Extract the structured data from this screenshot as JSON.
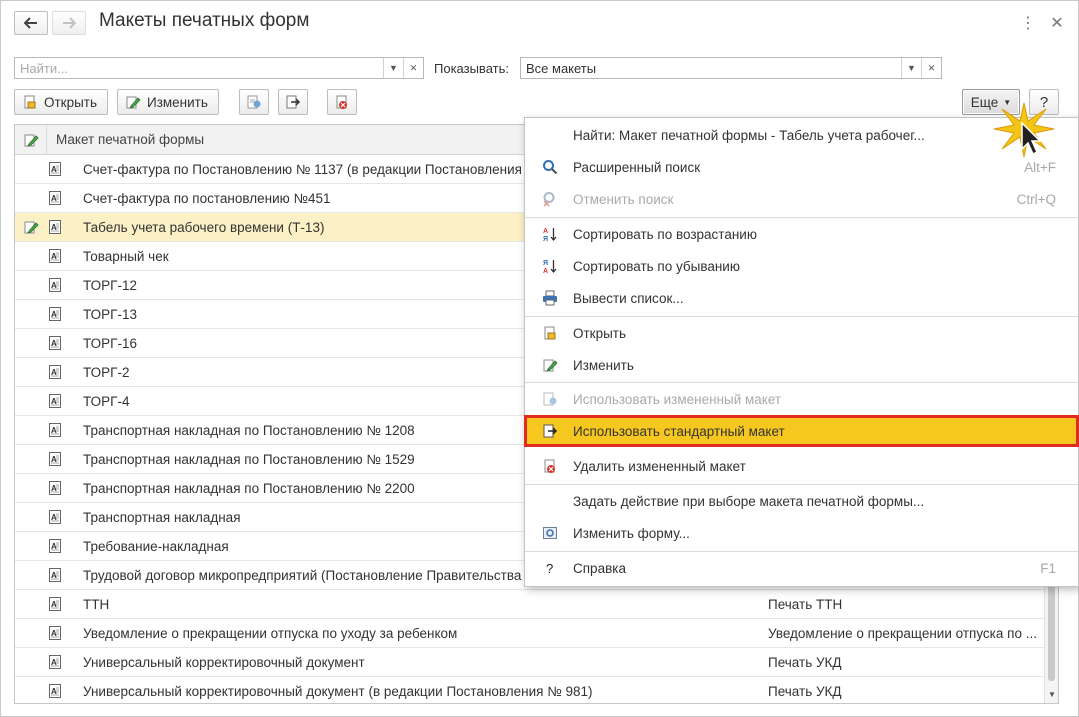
{
  "window": {
    "title": "Макеты печатных форм",
    "menu_icon": "⋮",
    "close_icon": "✕"
  },
  "filter": {
    "search_placeholder": "Найти...",
    "show_label": "Показывать:",
    "show_value": "Все макеты"
  },
  "toolbar": {
    "open_label": "Открыть",
    "edit_label": "Изменить",
    "more_label": "Еще",
    "help_label": "?"
  },
  "table": {
    "column_header": "Макет печатной формы",
    "rows": [
      {
        "name": "Счет-фактура по Постановлению № 1137 (в редакции Постановления N",
        "print": ""
      },
      {
        "name": "Счет-фактура по постановлению №451",
        "print": ""
      },
      {
        "name": "Табель учета рабочего времени (Т-13)",
        "print": "",
        "selected": true
      },
      {
        "name": "Товарный чек",
        "print": ""
      },
      {
        "name": "ТОРГ-12",
        "print": ""
      },
      {
        "name": "ТОРГ-13",
        "print": ""
      },
      {
        "name": "ТОРГ-16",
        "print": ""
      },
      {
        "name": "ТОРГ-2",
        "print": ""
      },
      {
        "name": "ТОРГ-4",
        "print": ""
      },
      {
        "name": "Транспортная накладная по Постановлению № 1208",
        "print": ""
      },
      {
        "name": "Транспортная накладная по Постановлению № 1529",
        "print": ""
      },
      {
        "name": "Транспортная накладная по Постановлению № 2200",
        "print": ""
      },
      {
        "name": "Транспортная накладная",
        "print": ""
      },
      {
        "name": "Требование-накладная",
        "print": ""
      },
      {
        "name": "Трудовой договор микропредприятий (Постановление Правительства Р",
        "print": ""
      },
      {
        "name": "ТТН",
        "print": "Печать ТТН"
      },
      {
        "name": "Уведомление о прекращении отпуска по уходу за ребенком",
        "print": "Уведомление о прекращении отпуска по ..."
      },
      {
        "name": "Универсальный корректировочный документ",
        "print": "Печать УКД"
      },
      {
        "name": "Универсальный корректировочный документ (в редакции Постановления № 981)",
        "print": "Печать УКД"
      }
    ]
  },
  "menu": {
    "items": [
      {
        "label": "Найти: Макет печатной формы - Табель учета рабочег...",
        "key": "",
        "icon": "none"
      },
      {
        "label": "Расширенный поиск",
        "key": "Alt+F",
        "icon": "magnifier-icon"
      },
      {
        "label": "Отменить поиск",
        "key": "Ctrl+Q",
        "icon": "cancel-search-icon",
        "disabled": true
      },
      {
        "label": "Сортировать по возрастанию",
        "key": "",
        "icon": "sort-asc-icon"
      },
      {
        "label": "Сортировать по убыванию",
        "key": "",
        "icon": "sort-desc-icon"
      },
      {
        "label": "Вывести список...",
        "key": "",
        "icon": "print-list-icon"
      },
      {
        "label": "Открыть",
        "key": "",
        "icon": "open-icon"
      },
      {
        "label": "Изменить",
        "key": "",
        "icon": "edit-icon"
      },
      {
        "label": "Использовать измененный макет",
        "key": "",
        "icon": "use-modified-icon",
        "disabled": true
      },
      {
        "label": "Использовать стандартный макет",
        "key": "",
        "icon": "use-standard-icon",
        "highlighted": true
      },
      {
        "label": "Удалить измененный макет",
        "key": "",
        "icon": "delete-modified-icon"
      },
      {
        "label": "Задать действие при выборе макета печатной формы...",
        "key": "",
        "icon": "none"
      },
      {
        "label": "Изменить форму...",
        "key": "",
        "icon": "form-settings-icon"
      },
      {
        "label": "Справка",
        "key": "F1",
        "icon": "help-icon"
      }
    ]
  },
  "colors": {
    "highlight": "#f6c71e",
    "highlight_border": "#e02b1f",
    "selected_row": "#fbf0c6"
  }
}
